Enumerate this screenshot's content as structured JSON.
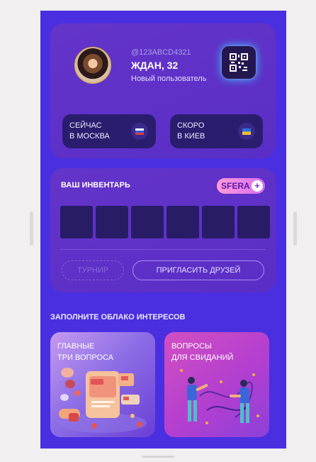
{
  "profile": {
    "user_id": "@123ABCD4321",
    "name": "ЖДАН, 32",
    "status": "Новый пользователь"
  },
  "location": {
    "now_line1": "СЕЙЧАС",
    "now_line2": "В МОСКВА",
    "next_line1": "СКОРО",
    "next_line2": "В КИЕВ"
  },
  "inventory": {
    "title": "ВАШ ИНВЕНТАРЬ",
    "badge": "SFERA",
    "slot_count": 6,
    "tournament_label": "ТУРНИР",
    "invite_label": "ПРИГЛАСИТЬ ДРУЗЕЙ"
  },
  "interests": {
    "title": "ЗАПОЛНИТЕ ОБЛАКО ИНТЕРЕСОВ",
    "tile1_line1": "ГЛАВНЫЕ",
    "tile1_line2": "ТРИ ВОПРОСА",
    "tile2_line1": "ВОПРОСЫ",
    "tile2_line2": "ДЛЯ СВИДАНИЙ"
  },
  "colors": {
    "background": "#4a2fe0",
    "card": "#5b30c9",
    "pill": "#2a1d6e",
    "slot": "#281c66",
    "accent_pink": "#ff9ad8"
  },
  "icons": [
    "qr-code-icon",
    "russia-flag-icon",
    "ukraine-flag-icon",
    "plus-icon"
  ]
}
